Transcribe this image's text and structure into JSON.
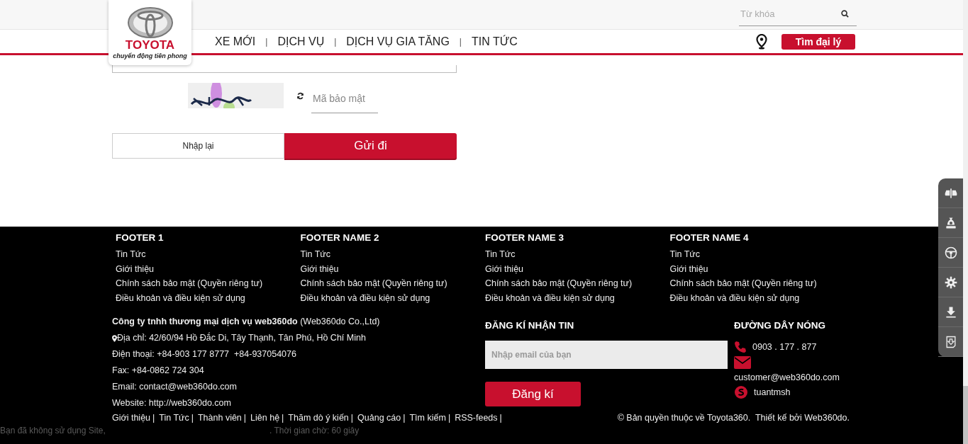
{
  "header": {
    "logo": {
      "brand": "TOYOTA",
      "slogan": "chuyển động tiên phong"
    },
    "search": {
      "placeholder": "Từ khóa"
    },
    "nav": {
      "separator": "|",
      "items": [
        {
          "label": "XE MỚI"
        },
        {
          "label": "DỊCH VỤ"
        },
        {
          "label": "DỊCH VỤ GIA TĂNG"
        },
        {
          "label": "TIN TỨC"
        }
      ]
    },
    "dealer_button": "Tìm đại lý"
  },
  "form": {
    "captcha_field": {
      "placeholder": "Mã bảo mật"
    },
    "reset_button": "Nhập lại",
    "submit_button": "Gửi đi"
  },
  "footer": {
    "columns": [
      {
        "title": "FOOTER 1",
        "links": [
          "Tin Tức",
          "Giới thiệu",
          "Chính sách bảo mật (Quyền riêng tư)",
          "Điều khoản và điều kiện sử dụng"
        ]
      },
      {
        "title": "FOOTER NAME 2",
        "links": [
          "Tin Tức",
          "Giới thiệu",
          "Chính sách bảo mật (Quyền riêng tư)",
          "Điều khoản và điều kiện sử dụng"
        ]
      },
      {
        "title": "FOOTER NAME 3",
        "links": [
          "Tin Tức",
          "Giới thiệu",
          "Chính sách bảo mật (Quyền riêng tư)",
          "Điều khoản và điều kiện sử dụng"
        ]
      },
      {
        "title": "FOOTER NAME 4",
        "links": [
          "Tin Tức",
          "Giới thiệu",
          "Chính sách bảo mật (Quyền riêng tư)",
          "Điều khoản và điều kiện sử dụng"
        ]
      }
    ],
    "company": {
      "name": "**Công ty tnhh thương mại dịch vụ web360do** (Web360do Co.,Ltd)",
      "address": "Địa chỉ: 42/60/94 Hồ Đắc Di, Tây Thạnh, Tân Phú, Hồ Chí Minh",
      "phone": "Điện thoại: +84-903 177 8777  +84-937054076",
      "fax": "Fax: +84-0862 724 304",
      "email": "Email: contact@web360do.com",
      "website": "Website: http://web360do.com"
    },
    "newsletter": {
      "title": "ĐĂNG KÍ NHẬN TIN",
      "placeholder": "Nhập email của bạn",
      "button": "Đăng kí"
    },
    "hotline": {
      "title": "ĐƯỜNG DÂY NÓNG",
      "phone": "0903 . 177 . 877",
      "email": "customer@web360do.com",
      "skype": "tuantmsh"
    },
    "bottom_links": {
      "separator": "|",
      "items": [
        "Giới thiệu",
        "Tin Tức",
        "Thành viên",
        "Liên hệ",
        "Thăm dò ý kiến",
        "Quảng cáo",
        "Tìm kiếm",
        "RSS-feeds"
      ]
    },
    "copyright": "© Bản quyền thuộc về Toyota360.  Thiết kế bởi Web360do.",
    "session_notice": [
      "Bạn đã không sử dụng Site,",
      ". Thời gian chờ: 60 giây"
    ]
  },
  "side_toolbar": [
    {
      "kind": "cars"
    },
    {
      "kind": "money"
    },
    {
      "kind": "wheel"
    },
    {
      "kind": "gear"
    },
    {
      "kind": "download"
    },
    {
      "kind": "document"
    }
  ]
}
